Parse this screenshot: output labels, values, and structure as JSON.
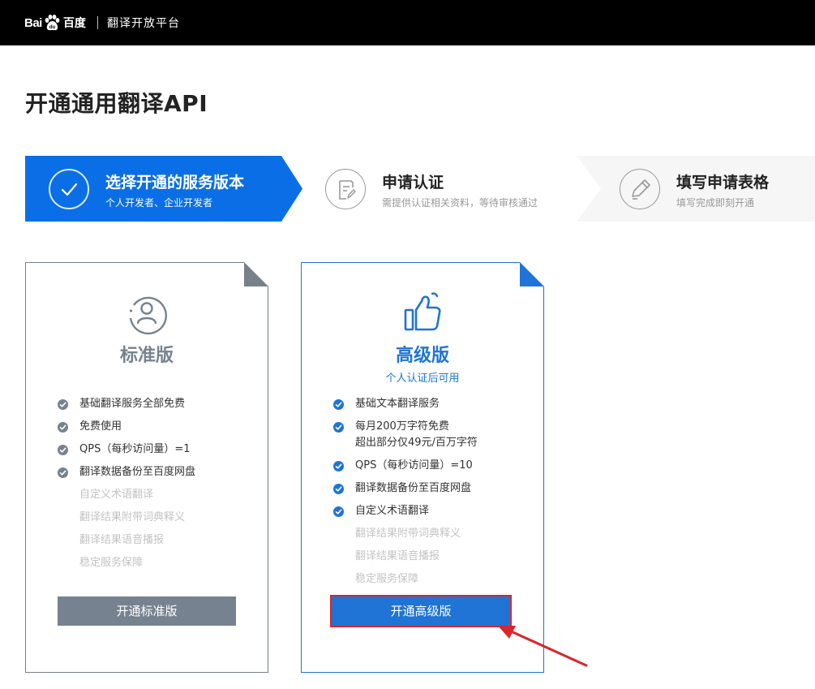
{
  "header": {
    "logo_left": "Bai",
    "logo_right": "百度",
    "platform": "翻译开放平台"
  },
  "page": {
    "title": "开通通用翻译API"
  },
  "steps": [
    {
      "title": "选择开通的服务版本",
      "subtitle": "个人开发者、企业开发者",
      "icon": "check-circle-icon",
      "active": true
    },
    {
      "title": "申请认证",
      "subtitle": "需提供认证相关资料，等待审核通过",
      "icon": "document-edit-icon",
      "active": false
    },
    {
      "title": "填写申请表格",
      "subtitle": "填写完成即刻开通",
      "icon": "pencil-icon",
      "active": false
    }
  ],
  "cards": {
    "standard": {
      "name": "标准版",
      "icon": "user-icon",
      "features": [
        {
          "lines": [
            "基础翻译服务全部免费"
          ],
          "enabled": true
        },
        {
          "lines": [
            "免费使用"
          ],
          "enabled": true
        },
        {
          "lines": [
            "QPS（每秒访问量）=1"
          ],
          "enabled": true
        },
        {
          "lines": [
            "翻译数据备份至百度网盘"
          ],
          "enabled": true
        },
        {
          "lines": [
            "自定义术语翻译"
          ],
          "enabled": false
        },
        {
          "lines": [
            "翻译结果附带词典释义"
          ],
          "enabled": false
        },
        {
          "lines": [
            "翻译结果语音播报"
          ],
          "enabled": false
        },
        {
          "lines": [
            "稳定服务保障"
          ],
          "enabled": false
        }
      ],
      "button": "开通标准版"
    },
    "advanced": {
      "name": "高级版",
      "note": "个人认证后可用",
      "icon": "thumbs-up-icon",
      "features": [
        {
          "lines": [
            "基础文本翻译服务"
          ],
          "enabled": true
        },
        {
          "lines": [
            "每月200万字符免费",
            "超出部分仅49元/百万字符"
          ],
          "enabled": true
        },
        {
          "lines": [
            "QPS（每秒访问量）=10"
          ],
          "enabled": true
        },
        {
          "lines": [
            "翻译数据备份至百度网盘"
          ],
          "enabled": true
        },
        {
          "lines": [
            "自定义术语翻译"
          ],
          "enabled": true
        },
        {
          "lines": [
            "翻译结果附带词典释义"
          ],
          "enabled": false
        },
        {
          "lines": [
            "翻译结果语音播报"
          ],
          "enabled": false
        },
        {
          "lines": [
            "稳定服务保障"
          ],
          "enabled": false
        }
      ],
      "button": "开通高级版"
    }
  },
  "colors": {
    "brand_blue": "#1f74d6",
    "step_active": "#0a6fe6",
    "standard_gray": "#76828f",
    "highlight_red": "#d9262c"
  }
}
